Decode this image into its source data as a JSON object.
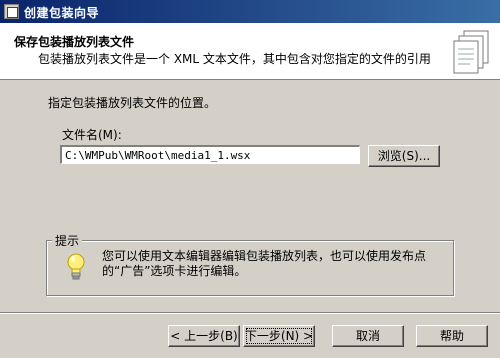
{
  "window": {
    "title": "创建包装向导",
    "icon": "wizard-window-icon"
  },
  "header": {
    "title": "保存包装播放列表文件",
    "subtitle": "包装播放列表文件是一个 XML 文本文件，其中包含对您指定的文件的引用",
    "icon": "documents-stack-icon"
  },
  "main": {
    "instruction": "指定包装播放列表文件的位置。",
    "filename_label": "文件名(M):",
    "filename_value": "C:\\WMPub\\WMRoot\\media1_1.wsx",
    "browse_label": "浏览(S)..."
  },
  "tip": {
    "legend": "提示",
    "icon": "lightbulb-icon",
    "text": "您可以使用文本编辑器编辑包装播放列表，也可以使用发布点的“广告”选项卡进行编辑。"
  },
  "footer": {
    "back_label": "< 上一步(B)",
    "next_label": "下一步(N) >",
    "cancel_label": "取消",
    "help_label": "帮助"
  }
}
